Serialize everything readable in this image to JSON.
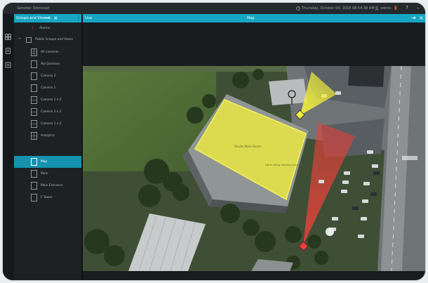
{
  "window": {
    "app_title": "Genetec Omnicast",
    "clock": "Thursday, October 04, 2018 08:54:38 AM",
    "user": "admin",
    "title_icons": [
      "bell-icon",
      "help-icon",
      "minimize-icon"
    ]
  },
  "left_rail": {
    "icons": [
      "tile-icon",
      "settings-icon",
      "camera-icon"
    ]
  },
  "groups_panel": {
    "title": "Groups and Views",
    "items": [
      {
        "label": "Alarms",
        "kind": "alarm"
      },
      {
        "label": "Public Groups and Views",
        "kind": "group"
      },
      {
        "label": "All cameras",
        "kind": "grid"
      },
      {
        "label": "Ala Quintaro",
        "kind": "single"
      },
      {
        "label": "Camera 2",
        "kind": "single"
      },
      {
        "label": "Camera 1",
        "kind": "single"
      },
      {
        "label": "Camera 1 x 2",
        "kind": "split"
      },
      {
        "label": "Camera 2 x 2",
        "kind": "split"
      },
      {
        "label": "Camera 1 x 2",
        "kind": "split"
      },
      {
        "label": "Analytics",
        "kind": "quad"
      },
      {
        "label": "Map",
        "kind": "single",
        "selected": true
      },
      {
        "label": "Main",
        "kind": "single"
      },
      {
        "label": "Main Entrance",
        "kind": "single"
      },
      {
        "label": "F Tower",
        "kind": "single"
      }
    ]
  },
  "map_panel": {
    "tab_label": "Live",
    "title": "Map",
    "building_label": "Studio Main Room",
    "building_sublabel": "North Wing Parking Area 02",
    "accent_color": "#16a6c4",
    "zone_color": "#f2ee3c",
    "camera_fov_color": "#e8413a"
  }
}
